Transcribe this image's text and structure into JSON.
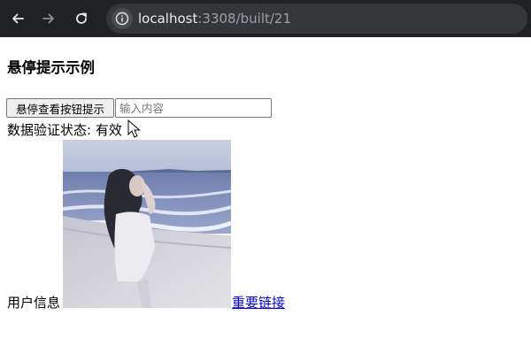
{
  "browser": {
    "url_host": "localhost",
    "url_rest": ":3308/built/21"
  },
  "icons": {
    "back": "arrow-left-icon",
    "forward": "arrow-right-icon",
    "reload": "reload-icon",
    "site_info": "info-icon"
  },
  "page": {
    "title": "悬停提示示例",
    "hover_button_label": "悬停查看按钮提示",
    "input_placeholder": "输入内容",
    "input_value": "",
    "status_text": "数据验证状态: 有效",
    "user_info_label": "用户信息",
    "link_text": "重要链接"
  },
  "colors": {
    "chrome_bg": "#202124",
    "omnibox_bg": "#35363a",
    "link": "#0000ee"
  }
}
